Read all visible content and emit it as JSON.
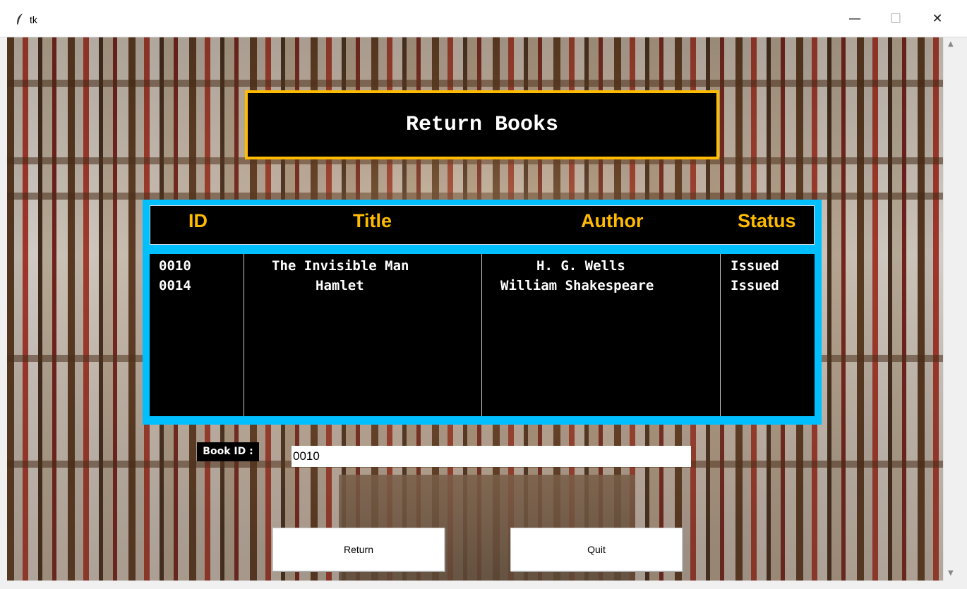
{
  "window": {
    "title": "tk",
    "minimize_glyph": "—",
    "maximize_glyph": "☐",
    "close_glyph": "✕"
  },
  "heading": {
    "title": "Return Books"
  },
  "table": {
    "columns": [
      "ID",
      "Title",
      "Author",
      "Status"
    ],
    "rows": [
      {
        "id": "0010",
        "title": "The Invisible Man",
        "author": "H. G. Wells",
        "status": "Issued"
      },
      {
        "id": "0014",
        "title": "Hamlet",
        "author": "William Shakespeare",
        "status": "Issued"
      }
    ]
  },
  "form": {
    "book_id_label": "Book ID :",
    "book_id_value": "0010"
  },
  "buttons": {
    "return_label": "Return",
    "quit_label": "Quit"
  },
  "colors": {
    "heading_border": "#ffbb00",
    "header_text": "#ffbb00",
    "table_frame": "#00bfff",
    "panel_bg": "#000000"
  },
  "icons": {
    "app_icon": "feather-icon",
    "scroll_up": "scroll-up-arrow-icon",
    "scroll_down": "scroll-down-arrow-icon"
  }
}
